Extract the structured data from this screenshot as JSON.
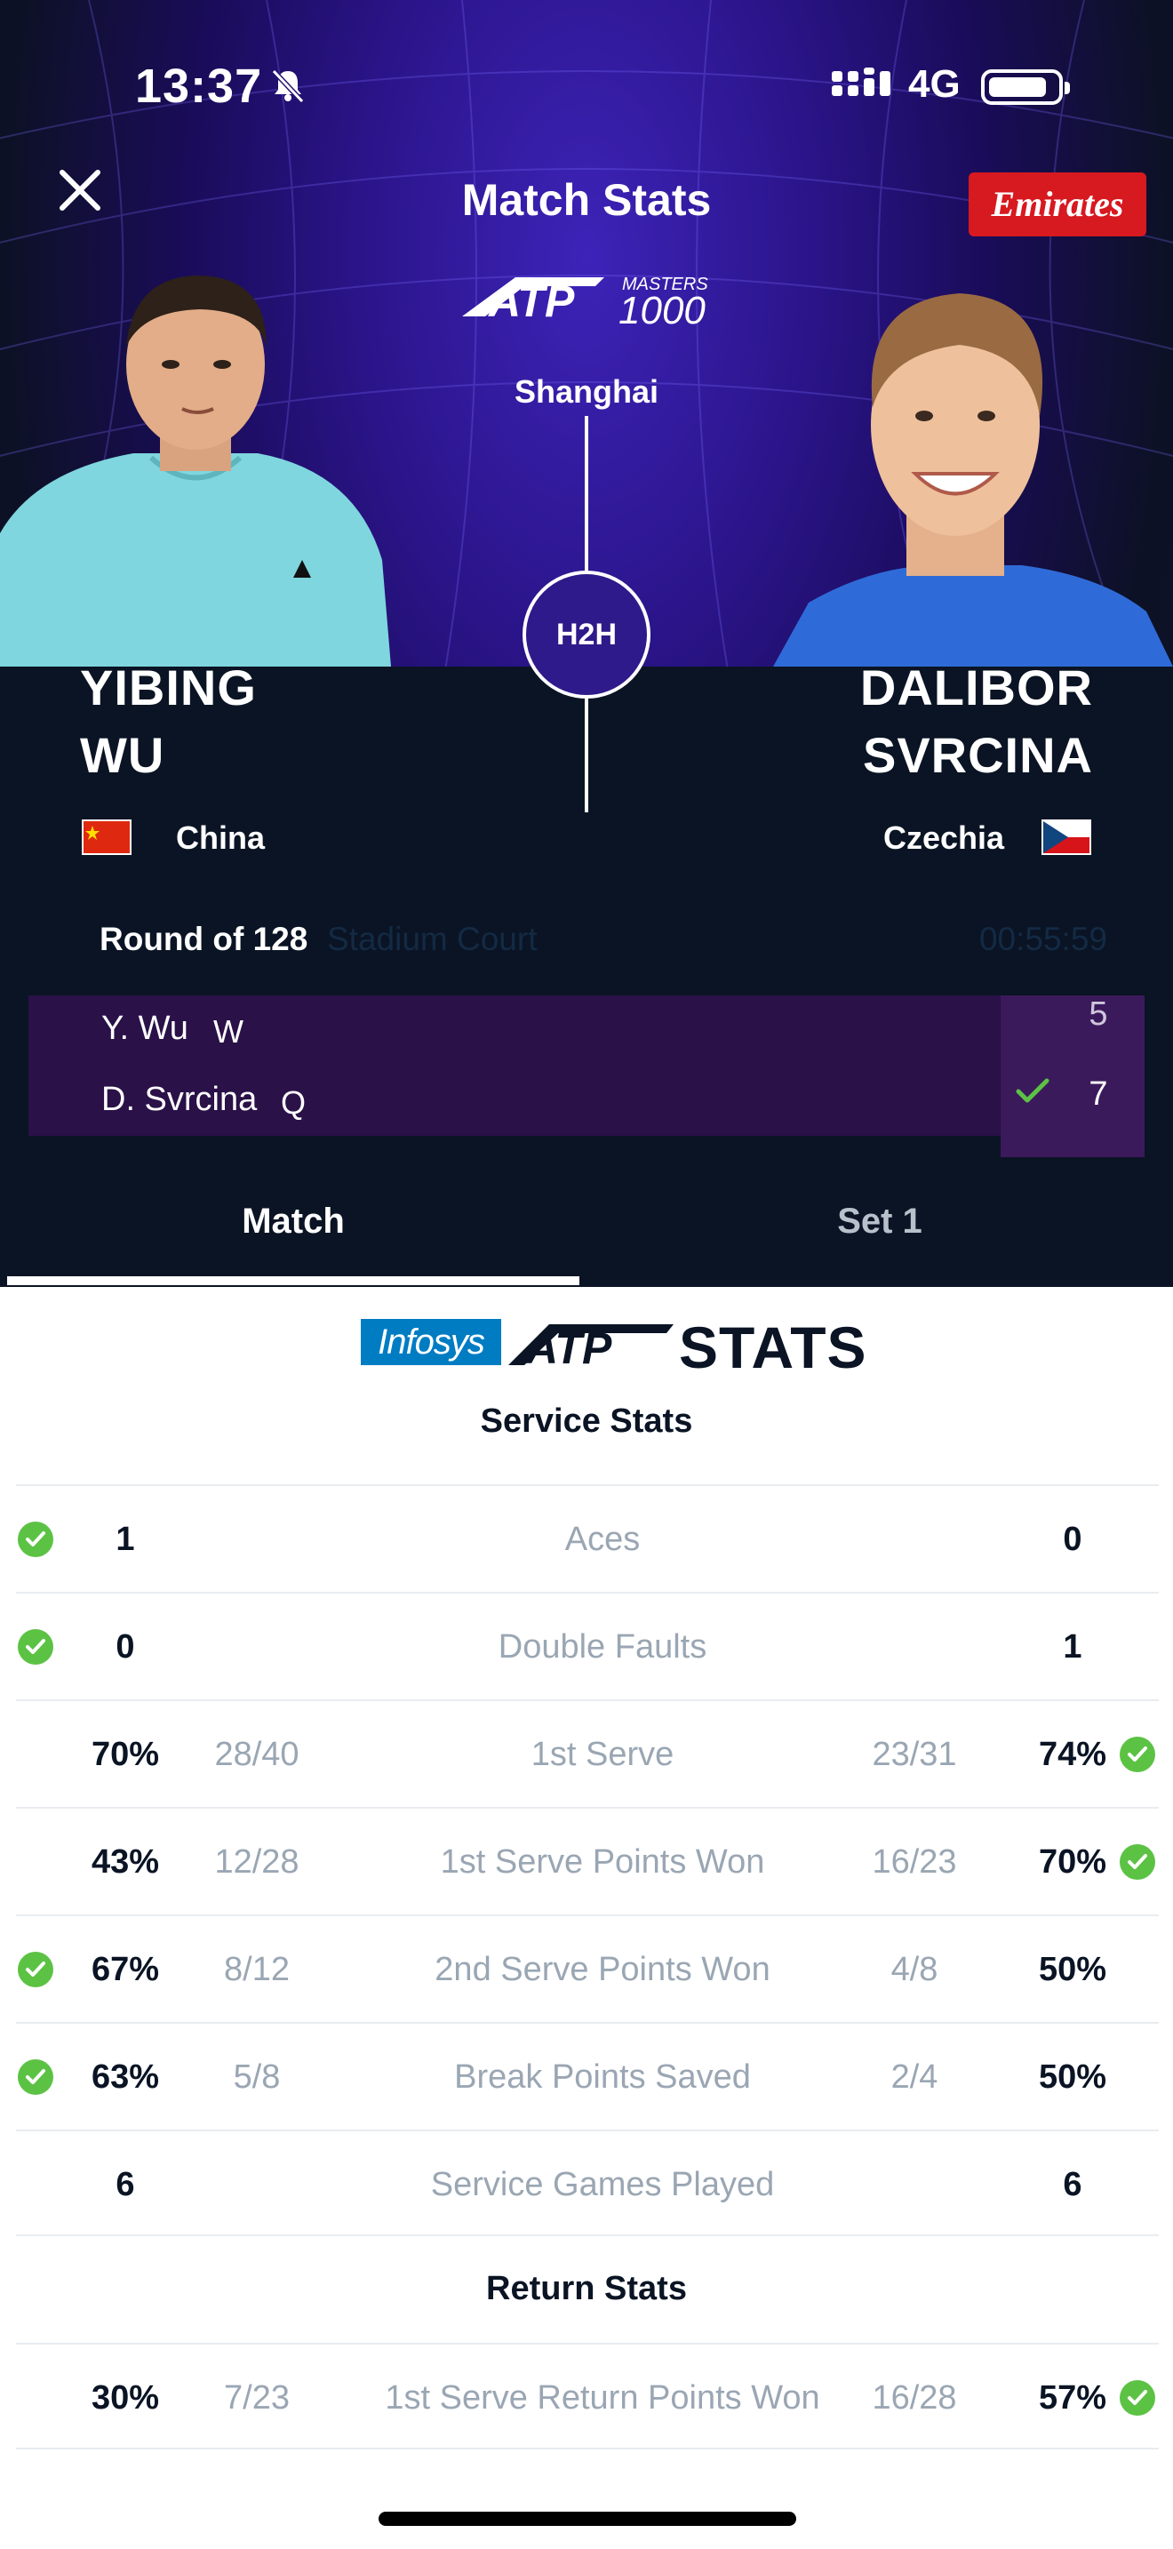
{
  "status_bar": {
    "time": "13:37",
    "network": "4G"
  },
  "header": {
    "title": "Match Stats",
    "sponsor": "Emirates",
    "tournament_logo_text": "ATP",
    "tournament_logo_sub_top": "MASTERS",
    "tournament_logo_sub": "1000",
    "city": "Shanghai",
    "h2h_label": "H2H"
  },
  "players": [
    {
      "first_name": "YIBING",
      "last_name": "WU",
      "country": "China",
      "flag": "china-flag"
    },
    {
      "first_name": "DALIBOR",
      "last_name": "SVRCINA",
      "country": "Czechia",
      "flag": "czechia-flag"
    }
  ],
  "match_info": {
    "round": "Round of 128",
    "court": "Stadium Court",
    "duration": "00:55:59"
  },
  "scoreboard": [
    {
      "name": "Y. Wu",
      "seed": "W",
      "sets": [
        "5"
      ],
      "winner": false
    },
    {
      "name": "D. Svrcina",
      "seed": "Q",
      "sets": [
        "7"
      ],
      "winner": true
    }
  ],
  "tabs": [
    {
      "label": "Match",
      "active": true
    },
    {
      "label": "Set 1",
      "active": false
    }
  ],
  "stats_branding": {
    "infosys": "Infosys",
    "atp": "ATP",
    "stats": "STATS"
  },
  "sections": {
    "service_title": "Service Stats",
    "return_title": "Return Stats"
  },
  "service_stats": [
    {
      "label": "Aces",
      "p1": "1",
      "p1_frac": "",
      "p2": "0",
      "p2_frac": "",
      "leader": "p1"
    },
    {
      "label": "Double Faults",
      "p1": "0",
      "p1_frac": "",
      "p2": "1",
      "p2_frac": "",
      "leader": "p1"
    },
    {
      "label": "1st Serve",
      "p1": "70%",
      "p1_frac": "28/40",
      "p2": "74%",
      "p2_frac": "23/31",
      "leader": "p2"
    },
    {
      "label": "1st Serve Points Won",
      "p1": "43%",
      "p1_frac": "12/28",
      "p2": "70%",
      "p2_frac": "16/23",
      "leader": "p2"
    },
    {
      "label": "2nd Serve Points Won",
      "p1": "67%",
      "p1_frac": "8/12",
      "p2": "50%",
      "p2_frac": "4/8",
      "leader": "p1"
    },
    {
      "label": "Break Points Saved",
      "p1": "63%",
      "p1_frac": "5/8",
      "p2": "50%",
      "p2_frac": "2/4",
      "leader": "p1"
    },
    {
      "label": "Service Games Played",
      "p1": "6",
      "p1_frac": "",
      "p2": "6",
      "p2_frac": "",
      "leader": "none"
    }
  ],
  "return_stats": [
    {
      "label": "1st Serve Return Points Won",
      "p1": "30%",
      "p1_frac": "7/23",
      "p2": "57%",
      "p2_frac": "16/28",
      "leader": "p2"
    }
  ],
  "colors": {
    "leader_check": "#5cc244",
    "sponsor_red": "#d71920",
    "score_bg": "#2a1148",
    "infosys_blue": "#007cc3"
  }
}
